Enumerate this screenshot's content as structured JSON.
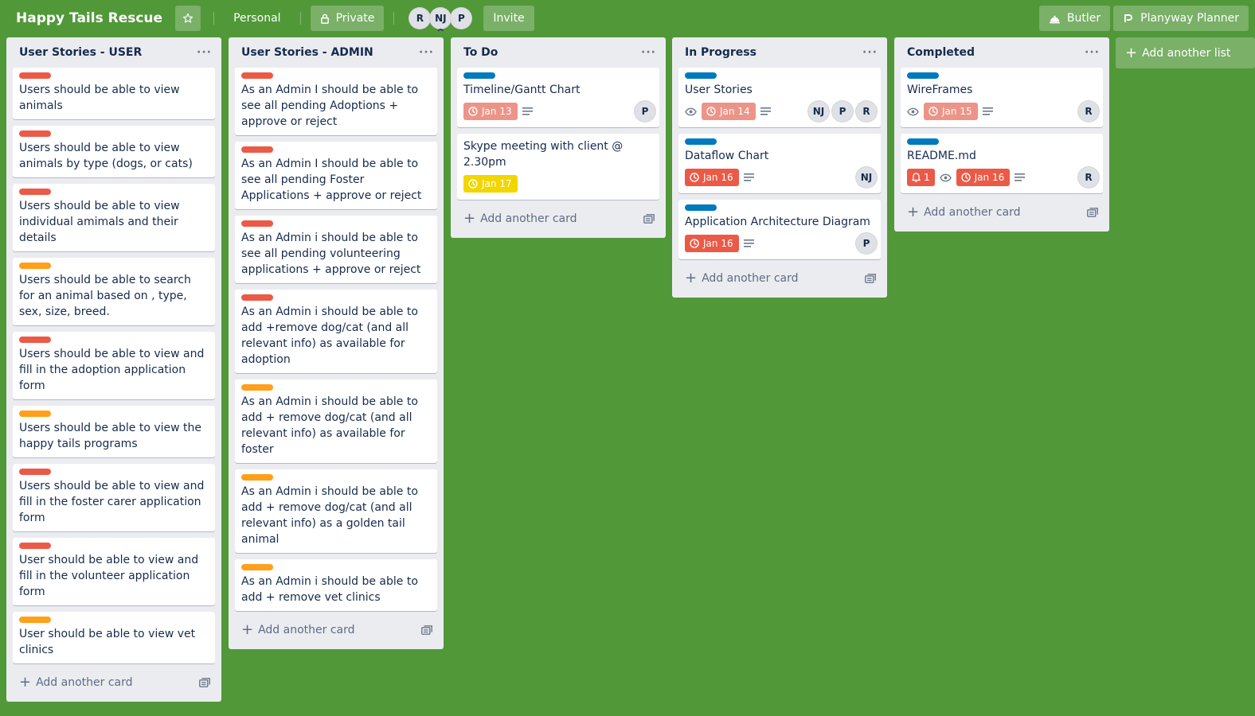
{
  "board": {
    "title": "Happy Tails Rescue",
    "team": "Personal",
    "visibility": "Private",
    "invite_label": "Invite",
    "members": [
      "R",
      "NJ",
      "P"
    ],
    "butler_label": "Butler",
    "planyway_label": "Planyway Planner",
    "add_list_label": "Add another list",
    "background_color": "#519839"
  },
  "colors": {
    "label_red": "#eb5a46",
    "label_orange": "#ff9f1a",
    "label_blue": "#0079bf",
    "date_overdue": "#eb5a46",
    "date_past_light": "#ec9488",
    "date_due_soon": "#f2d600"
  },
  "lists": [
    {
      "title": "User Stories - USER",
      "menu": "···",
      "add_label": "Add another card",
      "cards": [
        {
          "label": "red",
          "title": "Users should be able to view animals"
        },
        {
          "label": "red",
          "title": "Users should be able to view animals by type (dogs, or cats)"
        },
        {
          "label": "red",
          "title": "Users should be able to view individual amimals and their details"
        },
        {
          "label": "orange",
          "title": "Users should be able to search for an animal based on , type, sex, size, breed."
        },
        {
          "label": "red",
          "title": "Users should be able to view and fill in the adoption application form"
        },
        {
          "label": "orange",
          "title": "Users should be able to view the happy tails programs"
        },
        {
          "label": "red",
          "title": "Users should be able to view and fill in the foster carer application form"
        },
        {
          "label": "red",
          "title": "User should be able to view and fill in the volunteer application form"
        },
        {
          "label": "orange",
          "title": "User should be able to view vet clinics"
        }
      ]
    },
    {
      "title": "User Stories - ADMIN",
      "menu": "···",
      "add_label": "Add another card",
      "cards": [
        {
          "label": "red",
          "title": "As an Admin I should be able to see all pending Adoptions + approve or reject"
        },
        {
          "label": "red",
          "title": "As an Admin I should be able to see all pending Foster Applications + approve or reject"
        },
        {
          "label": "red",
          "title": "As an Admin i should be able to see all pending volunteering applications + approve or reject"
        },
        {
          "label": "red",
          "title": "As an Admin i should be able to add +remove dog/cat (and all relevant info) as available for adoption"
        },
        {
          "label": "orange",
          "title": "As an Admin i should be able to add + remove dog/cat (and all relevant info) as available for foster"
        },
        {
          "label": "orange",
          "title": "As an Admin i should be able to add + remove dog/cat (and all relevant info) as a golden tail animal"
        },
        {
          "label": "orange",
          "title": "As an Admin i should be able to add + remove vet clinics"
        }
      ]
    },
    {
      "title": "To Do",
      "menu": "···",
      "add_label": "Add another card",
      "cards": [
        {
          "label": "blue",
          "title": "Timeline/Gantt Chart",
          "date": "Jan 13",
          "date_style": "past",
          "description": true,
          "members": [
            "P"
          ]
        },
        {
          "title": "Skype meeting with client @ 2.30pm",
          "date": "Jan 17",
          "date_style": "soon"
        }
      ]
    },
    {
      "title": "In Progress",
      "menu": "···",
      "add_label": "Add another card",
      "cards": [
        {
          "label": "blue",
          "title": "User Stories",
          "watch": true,
          "date": "Jan 14",
          "date_style": "past",
          "description": true,
          "members": [
            "NJ",
            "P",
            "R"
          ]
        },
        {
          "label": "blue",
          "title": "Dataflow Chart",
          "date": "Jan 16",
          "date_style": "overdue",
          "description": true,
          "members": [
            "NJ"
          ]
        },
        {
          "label": "blue",
          "title": "Application Architecture Diagram",
          "date": "Jan 16",
          "date_style": "overdue",
          "description": true,
          "members": [
            "P"
          ]
        }
      ]
    },
    {
      "title": "Completed",
      "menu": "···",
      "add_label": "Add another card",
      "cards": [
        {
          "label": "blue",
          "title": "WireFrames",
          "watch": true,
          "date": "Jan 15",
          "date_style": "past",
          "description": true,
          "members": [
            "R"
          ]
        },
        {
          "label": "blue",
          "title": "README.md",
          "notification": "1",
          "watch": true,
          "date": "Jan 16",
          "date_style": "overdue",
          "description": true,
          "members": [
            "R"
          ]
        }
      ]
    }
  ]
}
